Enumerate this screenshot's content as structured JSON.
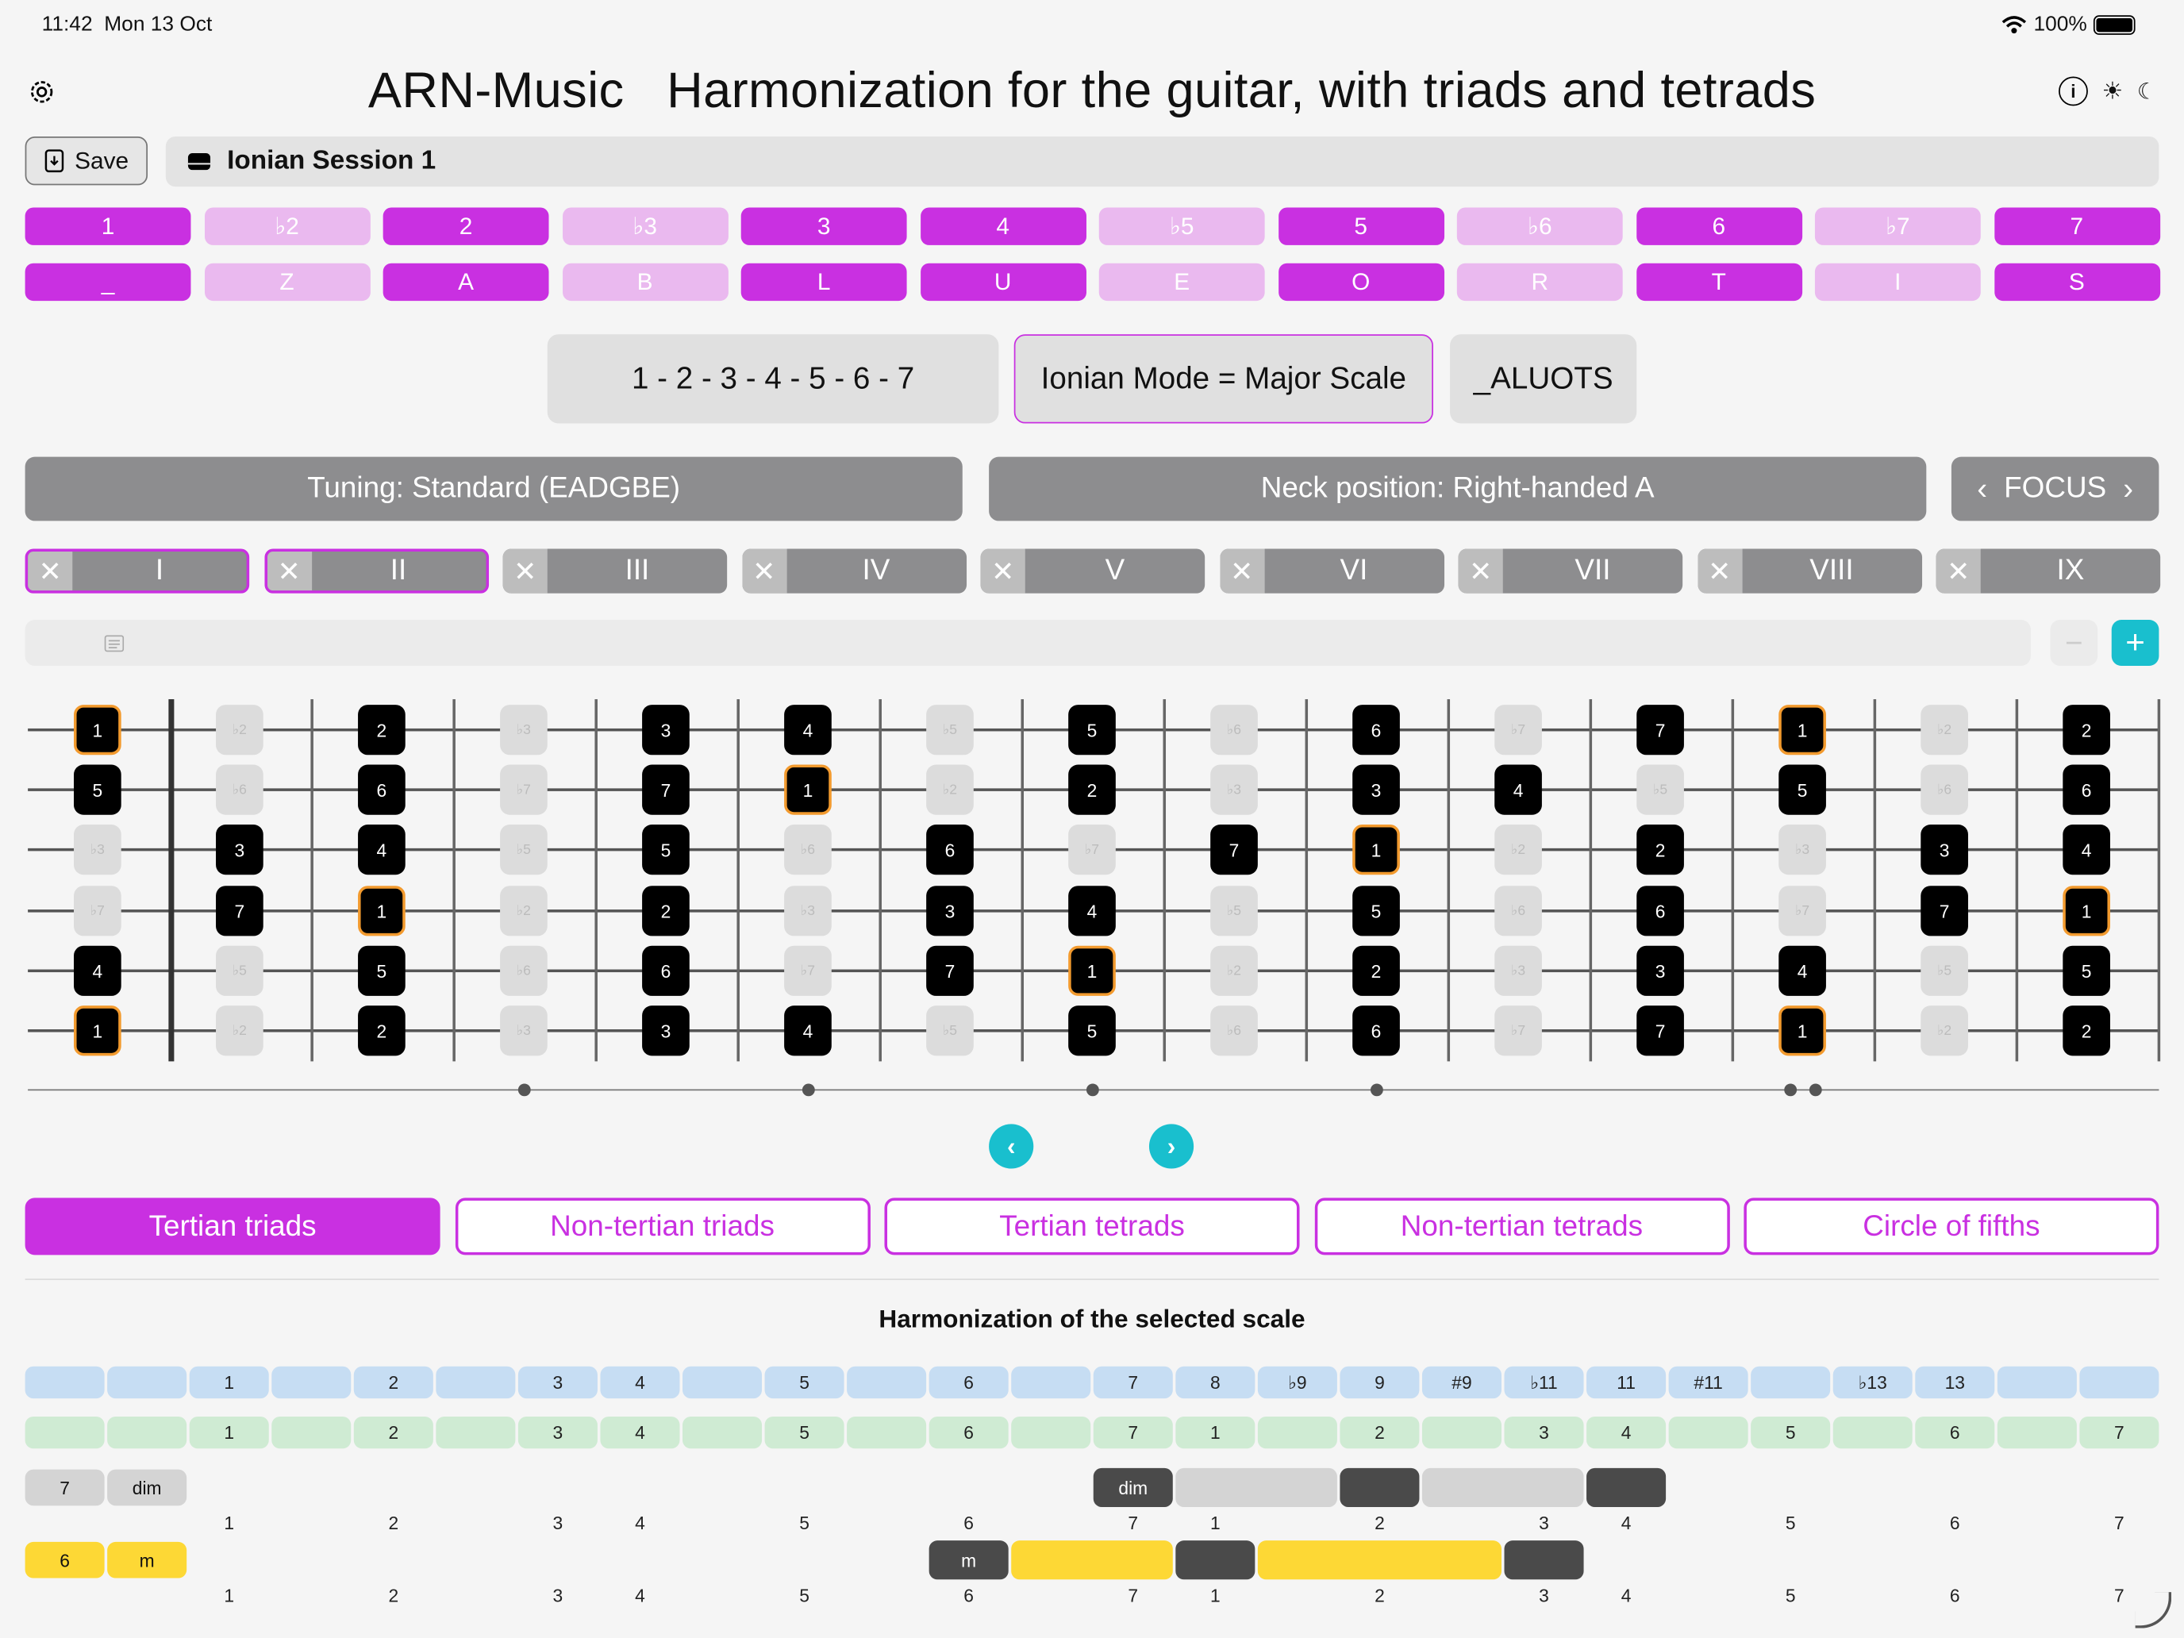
{
  "status": {
    "time": "11:42",
    "date": "Mon 13 Oct",
    "battery": "100%"
  },
  "title": "ARN-Music   Harmonization for the guitar, with triads and tetrads",
  "toolbar": {
    "save_label": "Save",
    "session_name": "Ionian Session 1"
  },
  "icons": {
    "settings": "gear-icon",
    "info": "info-icon",
    "light": "sun-icon",
    "dark": "moon-icon"
  },
  "intervals": [
    {
      "label": "1",
      "on": true
    },
    {
      "label": "♭2",
      "on": false
    },
    {
      "label": "2",
      "on": true
    },
    {
      "label": "♭3",
      "on": false
    },
    {
      "label": "3",
      "on": true
    },
    {
      "label": "4",
      "on": true
    },
    {
      "label": "♭5",
      "on": false
    },
    {
      "label": "5",
      "on": true
    },
    {
      "label": "♭6",
      "on": false
    },
    {
      "label": "6",
      "on": true
    },
    {
      "label": "♭7",
      "on": false
    },
    {
      "label": "7",
      "on": true
    }
  ],
  "letters": [
    {
      "label": "_",
      "on": true
    },
    {
      "label": "Z",
      "on": false
    },
    {
      "label": "A",
      "on": true
    },
    {
      "label": "B",
      "on": false
    },
    {
      "label": "L",
      "on": true
    },
    {
      "label": "U",
      "on": true
    },
    {
      "label": "E",
      "on": false
    },
    {
      "label": "O",
      "on": true
    },
    {
      "label": "R",
      "on": false
    },
    {
      "label": "T",
      "on": true
    },
    {
      "label": "I",
      "on": false
    },
    {
      "label": "S",
      "on": true
    }
  ],
  "scale": {
    "formula": "1 - 2 - 3 - 4 - 5 - 6 - 7",
    "mode": "Ionian Mode = Major Scale",
    "code": "_ALUOTS"
  },
  "settings": {
    "tuning": "Tuning: Standard (EADGBE)",
    "neck": "Neck position: Right-handed A",
    "focus": "FOCUS"
  },
  "degrees": [
    {
      "label": "I",
      "selected": true
    },
    {
      "label": "II",
      "selected": true
    },
    {
      "label": "III",
      "selected": false
    },
    {
      "label": "IV",
      "selected": false
    },
    {
      "label": "V",
      "selected": false
    },
    {
      "label": "VI",
      "selected": false
    },
    {
      "label": "VII",
      "selected": false
    },
    {
      "label": "VIII",
      "selected": false
    },
    {
      "label": "IX",
      "selected": false
    }
  ],
  "fretboard": {
    "strings": [
      [
        "1",
        "♭2",
        "2",
        "♭3",
        "3",
        "4",
        "♭5",
        "5",
        "♭6",
        "6",
        "♭7",
        "7",
        "1",
        "♭2",
        "2"
      ],
      [
        "5",
        "♭6",
        "6",
        "♭7",
        "7",
        "1",
        "♭2",
        "2",
        "♭3",
        "3",
        "4",
        "♭5",
        "5",
        "♭6",
        "6"
      ],
      [
        "♭3",
        "3",
        "4",
        "♭5",
        "5",
        "♭6",
        "6",
        "♭7",
        "7",
        "1",
        "♭2",
        "2",
        "♭3",
        "3",
        "4"
      ],
      [
        "♭7",
        "7",
        "1",
        "♭2",
        "2",
        "♭3",
        "3",
        "4",
        "♭5",
        "5",
        "♭6",
        "6",
        "♭7",
        "7",
        "1"
      ],
      [
        "4",
        "♭5",
        "5",
        "♭6",
        "6",
        "♭7",
        "7",
        "1",
        "♭2",
        "2",
        "♭3",
        "3",
        "4",
        "♭5",
        "5"
      ],
      [
        "1",
        "♭2",
        "2",
        "♭3",
        "3",
        "4",
        "♭5",
        "5",
        "♭6",
        "6",
        "♭7",
        "7",
        "1",
        "♭2",
        "2"
      ]
    ],
    "markers": [
      3,
      5,
      7,
      9,
      12
    ]
  },
  "tabs": [
    {
      "label": "Tertian triads",
      "active": true
    },
    {
      "label": "Non-tertian triads",
      "active": false
    },
    {
      "label": "Tertian tetrads",
      "active": false
    },
    {
      "label": "Non-tertian tetrads",
      "active": false
    },
    {
      "label": "Circle of fifths",
      "active": false
    }
  ],
  "harmonization": {
    "heading": "Harmonization of the selected scale",
    "blue_row": [
      "",
      "",
      "1",
      "",
      "2",
      "",
      "3",
      "4",
      "",
      "5",
      "",
      "6",
      "",
      "7",
      "8",
      "♭9",
      "9",
      "#9",
      "♭11",
      "11",
      "#11",
      "",
      "♭13",
      "13",
      "",
      ""
    ],
    "green_row": [
      "",
      "",
      "1",
      "",
      "2",
      "",
      "3",
      "4",
      "",
      "5",
      "",
      "6",
      "",
      "7",
      "1",
      "",
      "2",
      "",
      "3",
      "4",
      "",
      "5",
      "",
      "6",
      "",
      "7"
    ],
    "chords": [
      {
        "degree": "7",
        "quality": "dim",
        "color": "#d4d4d4",
        "highlight_color": "#4a4a4a",
        "label_in_row": "dim",
        "row_numbers": [
          "",
          "",
          "1",
          "",
          "2",
          "",
          "3",
          "4",
          "",
          "5",
          "",
          "6",
          "",
          "7",
          "1",
          "",
          "2",
          "",
          "3",
          "4",
          "",
          "5",
          "",
          "6",
          "",
          "7"
        ]
      },
      {
        "degree": "6",
        "quality": "m",
        "color": "#fdd835",
        "highlight_color": "#4a4a4a",
        "label_in_row": "m",
        "row_numbers": [
          "",
          "",
          "1",
          "",
          "2",
          "",
          "3",
          "4",
          "",
          "5",
          "",
          "6",
          "",
          "7",
          "1",
          "",
          "2",
          "",
          "3",
          "4",
          "",
          "5",
          "",
          "6",
          "",
          "7"
        ]
      }
    ]
  },
  "colors": {
    "accent": "#c930e1",
    "accent_light": "#eab9ef",
    "teal": "#19bfce",
    "root_border": "#f29a2e"
  }
}
